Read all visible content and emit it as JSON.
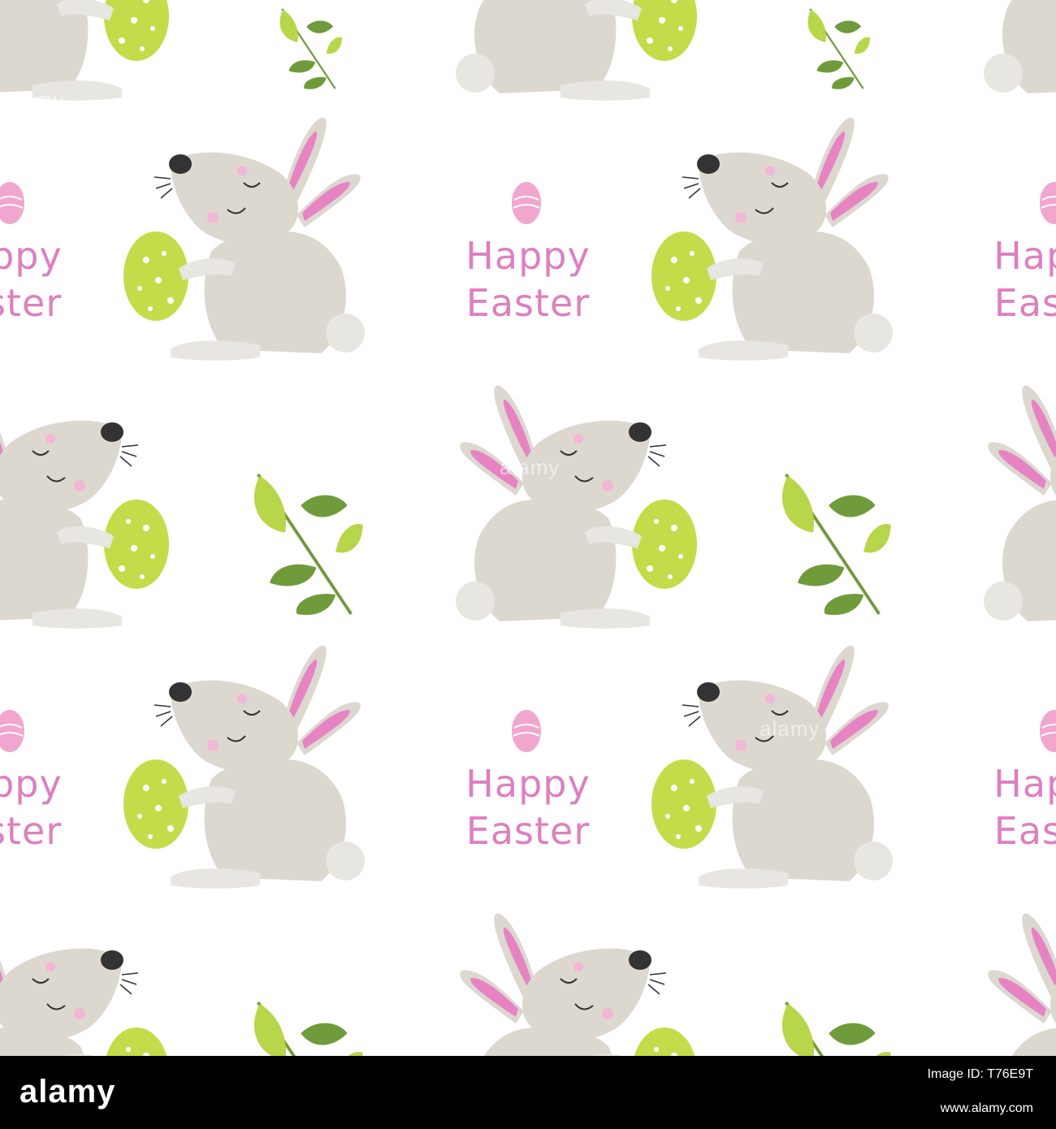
{
  "image": {
    "description_type": "seamless pattern",
    "background_color": "#ffffff",
    "palette": {
      "bunny_fur": "#dcd8d0",
      "bunny_shade": "#c9c4bb",
      "ear_inner": "#e684c3",
      "nose": "#333333",
      "egg_green": "#c5dc4a",
      "leaf_dark": "#6f9b3a",
      "leaf_light": "#b8d64a",
      "text_pink": "#de7fbf",
      "egg_pink": "#f1a6cf"
    }
  },
  "greeting": {
    "text": "Happy\nEaster"
  },
  "watermark": {
    "pattern_text": "alamy",
    "footer_logo": "alamy",
    "image_id_label": "Image ID: T76E9T",
    "url": "www.alamy.com"
  },
  "motifs": {
    "bunny_right": {
      "icon": "bunny-right-icon"
    },
    "bunny_left": {
      "icon": "bunny-left-icon"
    },
    "leaf_branch": {
      "icon": "leaf-branch-icon"
    },
    "pink_egg": {
      "icon": "easter-egg-icon"
    }
  }
}
